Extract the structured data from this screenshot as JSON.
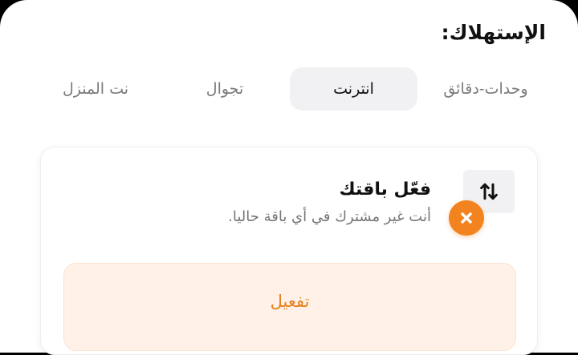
{
  "header": {
    "title": "الإستهلاك:"
  },
  "tabs": [
    {
      "label": "وحدات-دقائق",
      "active": false
    },
    {
      "label": "انترنت",
      "active": true
    },
    {
      "label": "تجوال",
      "active": false
    },
    {
      "label": "نت المنزل",
      "active": false
    }
  ],
  "package_card": {
    "heading": "فعّل باقتك",
    "status_text": "أنت غير مشترك في أي باقة حاليا.",
    "swap_icon": "swap-vertical-icon",
    "status_icon": "close-circle-icon",
    "activate_label": "تفعيل"
  },
  "colors": {
    "accent_orange": "#f2831f",
    "activate_bg": "#fff1e7",
    "activate_text": "#e8801f",
    "tab_active_bg": "#f1f1f3"
  }
}
